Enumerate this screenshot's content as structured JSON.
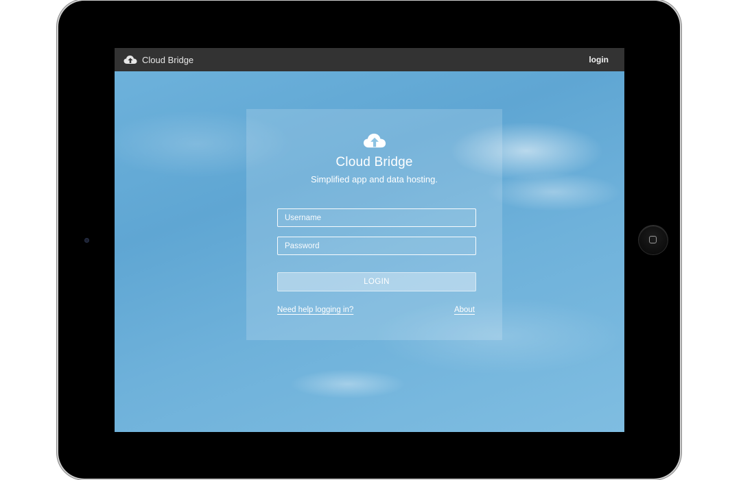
{
  "header": {
    "brand_title": "Cloud Bridge",
    "login_link": "login"
  },
  "login_panel": {
    "title": "Cloud Bridge",
    "subtitle": "Simplified app and data hosting.",
    "username_placeholder": "Username",
    "password_placeholder": "Password",
    "login_button": "LOGIN",
    "help_link": "Need help logging in?",
    "about_link": "About"
  },
  "colors": {
    "topbar": "#333333",
    "sky": "#6fb3dc"
  },
  "icons": {
    "brand": "cloud-upload-icon",
    "panel": "cloud-upload-icon",
    "home_button": "home-square-icon"
  }
}
